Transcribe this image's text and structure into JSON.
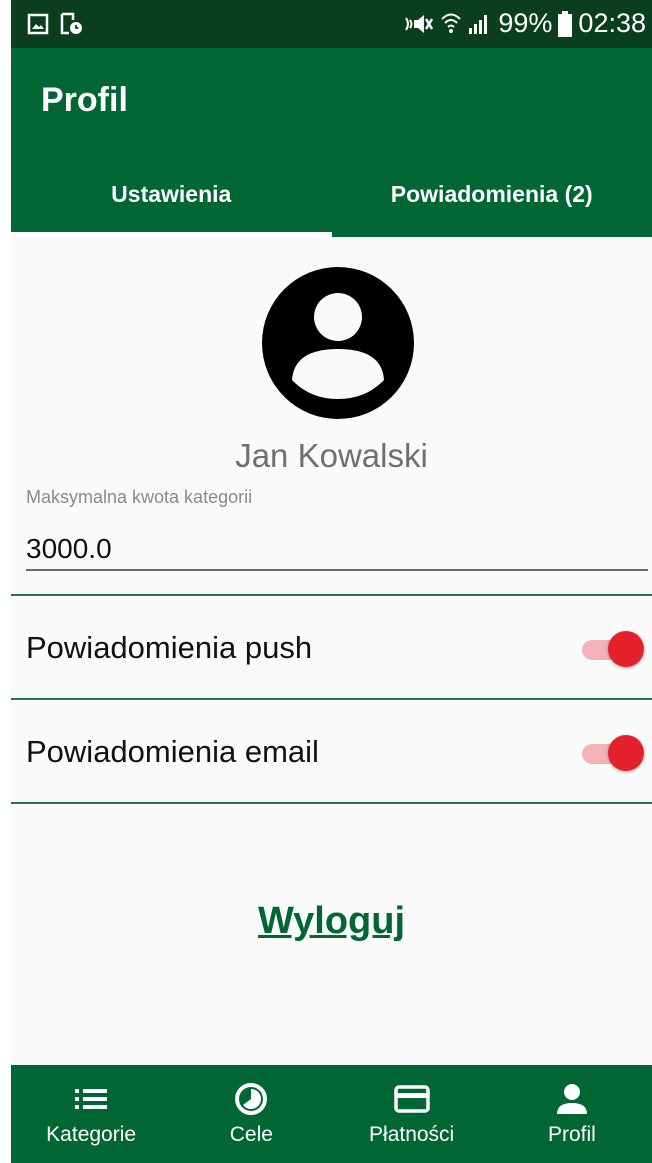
{
  "status_bar": {
    "battery": "99%",
    "time": "02:38"
  },
  "app_bar": {
    "title": "Profil"
  },
  "tabs": [
    {
      "label": "Ustawienia",
      "active": true
    },
    {
      "label": "Powiadomienia (2)",
      "active": false
    }
  ],
  "profile": {
    "name": "Jan Kowalski",
    "avatar_icon": "account-circle-icon"
  },
  "max_amount_field": {
    "label": "Maksymalna kwota kategorii",
    "value": "3000.0"
  },
  "settings": [
    {
      "label": "Powiadomienia push",
      "enabled": true
    },
    {
      "label": "Powiadomienia email",
      "enabled": true
    }
  ],
  "logout_label": "Wyloguj",
  "bottom_nav": [
    {
      "label": "Kategorie",
      "icon": "list-icon"
    },
    {
      "label": "Cele",
      "icon": "pie-chart-icon"
    },
    {
      "label": "Płatności",
      "icon": "credit-card-icon"
    },
    {
      "label": "Profil",
      "icon": "person-icon"
    }
  ],
  "colors": {
    "primary": "#006633",
    "status_bar": "#0b3d1f",
    "switch_on": "#e5212b",
    "switch_track": "#f3b3b6"
  }
}
